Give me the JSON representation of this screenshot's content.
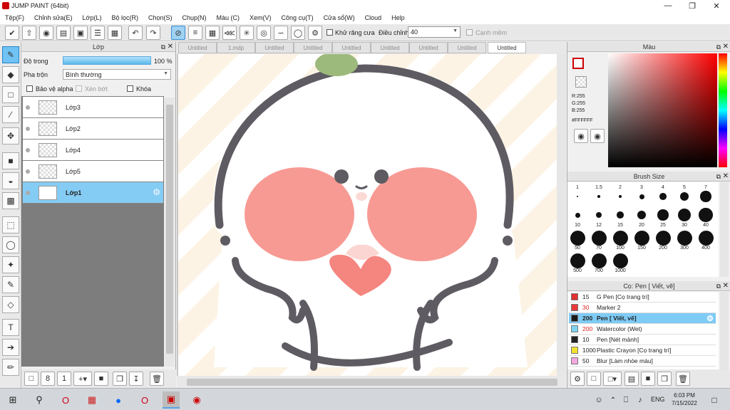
{
  "window": {
    "title": "JUMP PAINT (64bit)"
  },
  "menu": [
    "Tệp(F)",
    "Chỉnh sửa(E)",
    "Lớp(L)",
    "Bộ lọc(R)",
    "Chọn(S)",
    "Chụp(N)",
    "Màu (C)",
    "Xem(V)",
    "Công cụ(T)",
    "Cửa sổ(W)",
    "Cloud",
    "Help"
  ],
  "toolbar": {
    "antialias_label": "Khử răng cưa",
    "adjust_label": "Điều chỉnh",
    "adjust_value": "40",
    "snap_label": "Cạnh mềm"
  },
  "layer_panel": {
    "title": "Lớp",
    "opacity_label": "Độ trong",
    "opacity_value": "100 %",
    "blend_label": "Pha trộn",
    "blend_value": "Bình thường",
    "protect_alpha": "Bảo vệ alpha",
    "clip": "Xén bớt",
    "lock": "Khóa",
    "layers": [
      {
        "name": "Lớp3"
      },
      {
        "name": "Lớp2"
      },
      {
        "name": "Lớp4"
      },
      {
        "name": "Lớp5"
      },
      {
        "name": "Lớp1",
        "selected": true
      }
    ]
  },
  "tabs": [
    "Untitled",
    "1.mdp",
    "Untitled",
    "Untitled",
    "Untitled",
    "Untitled",
    "Untitled",
    "Untitled",
    "Untitled"
  ],
  "color_panel": {
    "title": "Màu",
    "r": "R:255",
    "g": "G:255",
    "b": "B:255",
    "hex": "#FFFFFF"
  },
  "brush_size_panel": {
    "title": "Brush Size",
    "sizes": [
      "1",
      "1.5",
      "2",
      "3",
      "4",
      "5",
      "7",
      "10",
      "12",
      "15",
      "20",
      "25",
      "30",
      "40",
      "50",
      "70",
      "100",
      "150",
      "200",
      "300",
      "400",
      "500",
      "700",
      "1000"
    ]
  },
  "brush_list_panel": {
    "title": "Cọ: Pen [ Viết, vẽ]",
    "brushes": [
      {
        "size": "15",
        "name": "G Pen [Cọ trang trí]",
        "color": "#e03030"
      },
      {
        "size": "30",
        "name": "Marker 2",
        "color": "#e83a3a"
      },
      {
        "size": "200",
        "name": "Pen [ Viết, vẽ]",
        "color": "#1a1a1a",
        "selected": true
      },
      {
        "size": "200",
        "name": "Watercolor (Wet)",
        "color": "#7fd4f0"
      },
      {
        "size": "10",
        "name": "Pen [Nét mảnh]",
        "color": "#222222"
      },
      {
        "size": "1000",
        "name": "Plastic Crayon [Cọ trang trí]",
        "color": "#f0e030"
      },
      {
        "size": "50",
        "name": "Blur [Làm nhòe màu]",
        "color": "#f4a8e0"
      }
    ]
  },
  "taskbar": {
    "lang": "ENG",
    "time": "6:03 PM",
    "date": "7/15/2022"
  },
  "colors": {
    "accent": "#85ccf4",
    "selected": "#7ecbf5",
    "line": "#5e5b62",
    "cheek": "#f79a93",
    "heart": "#f5857f"
  }
}
